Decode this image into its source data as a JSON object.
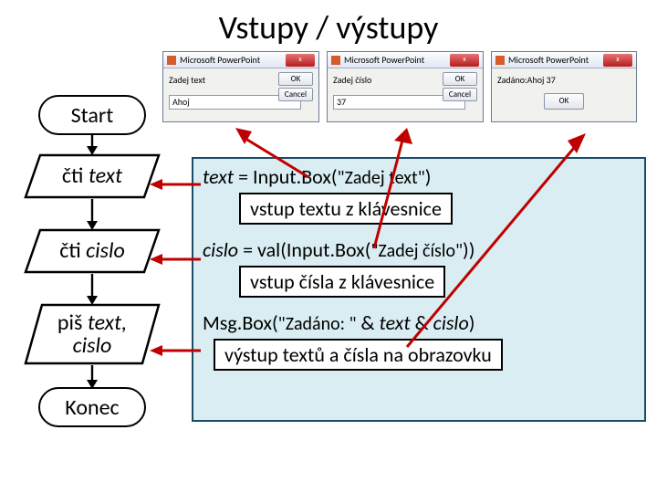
{
  "title": "Vstupy / výstupy",
  "dialogs": [
    {
      "app": "Microsoft PowerPoint",
      "prompt": "Zadej text",
      "input": "Ahoj",
      "buttons": [
        "OK",
        "Cancel"
      ],
      "close": "x"
    },
    {
      "app": "Microsoft PowerPoint",
      "prompt": "Zadej číslo",
      "input": "37",
      "buttons": [
        "OK",
        "Cancel"
      ],
      "close": "x"
    },
    {
      "app": "Microsoft PowerPoint",
      "prompt": "Zadáno:Ahoj 37",
      "input": "",
      "buttons": [
        "OK"
      ],
      "close": "x"
    }
  ],
  "flow": {
    "start": "Start",
    "cti_text": {
      "pre": "čti ",
      "var": "text"
    },
    "cti_cislo": {
      "pre": "čti ",
      "var": "cislo"
    },
    "pis": {
      "pre": "piš ",
      "vars": "text,\ncislo"
    },
    "end": "Konec"
  },
  "code": {
    "line1": {
      "lhs": "text",
      "eq": " = Input.Box(",
      "arg": "\"Zadej text\"",
      "tail": ")"
    },
    "explain1": "vstup textu z klávesnice",
    "line2": {
      "lhs": "cislo",
      "eq": " = val(Input.Box(",
      "arg": "\"Zadej číslo\"",
      "tail": "))"
    },
    "explain2": "vstup čísla z klávesnice",
    "line3": {
      "fn": "Msg.Box(",
      "arg": "\"Zadáno: \"",
      "amp1": " & ",
      "v1": "text",
      "amp2": " & ",
      "v2": "cislo",
      "tail": ")"
    },
    "explain3": "výstup textů a čísla na obrazovku"
  }
}
